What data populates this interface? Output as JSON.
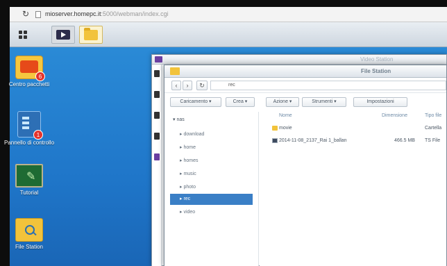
{
  "browser": {
    "reload_glyph": "↻",
    "url_host": "mioserver.homepc.it",
    "url_rest": ":5000/webman/index.cgi"
  },
  "desktop": {
    "icons": [
      {
        "label": "Centro pacchetti",
        "badge": "6"
      },
      {
        "label": "Pannello di controllo",
        "badge": "1"
      },
      {
        "label": "Tutorial",
        "badge": ""
      },
      {
        "label": "File Station",
        "badge": ""
      }
    ]
  },
  "video_station": {
    "title": "Video Station"
  },
  "file_station": {
    "title": "File Station",
    "nav": {
      "back": "‹",
      "forward": "›",
      "refresh": "↻",
      "path": "rec"
    },
    "toolbar": {
      "upload": "Caricamento ▾",
      "create": "Crea ▾",
      "action": "Azione ▾",
      "tools": "Strumenti ▾",
      "settings": "Impostazioni"
    },
    "tree": {
      "root": "▾ nas",
      "items": [
        "▸ download",
        "▸ home",
        "▸ homes",
        "▸ music",
        "▸ photo",
        "▸ rec",
        "▸ video"
      ],
      "selected_index": 5
    },
    "columns": {
      "name": "Nome",
      "size": "Dimensione",
      "type": "Tipo file"
    },
    "files": [
      {
        "name": "movie",
        "size": "",
        "type": "Cartella",
        "kind": "folder"
      },
      {
        "name": "2014-11-08_2137_Rai 1_ballan",
        "size": "466.5 MB",
        "type": "TS File",
        "kind": "video"
      }
    ]
  }
}
